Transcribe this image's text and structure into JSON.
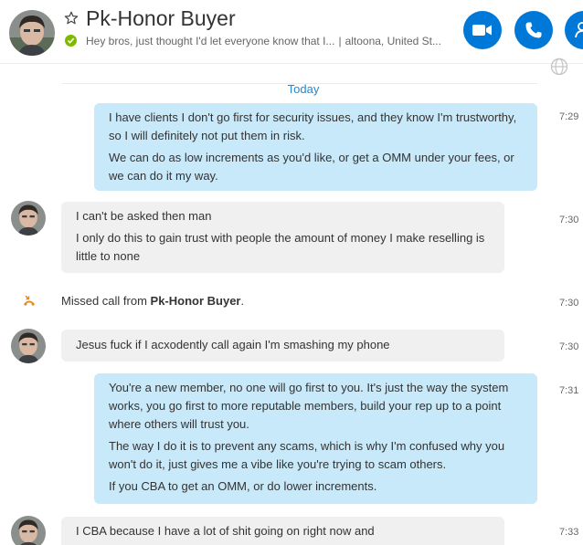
{
  "contact": {
    "name": "Pk-Honor Buyer",
    "mood": "Hey bros, just thought I'd let everyone know that I...",
    "separator": "|",
    "location": "altoona, United St..."
  },
  "colors": {
    "accent": "#0078d7",
    "outgoing_bubble": "#c7e9fa",
    "incoming_bubble": "#f0f0f0",
    "online": "#7fba00",
    "date": "#1e88d6",
    "missed_call": "#e8881a"
  },
  "icons": {
    "favorite": "star-icon",
    "status": "online-check-icon",
    "video": "video-camera-icon",
    "call": "phone-icon",
    "add": "add-people-icon",
    "translate": "globe-icon",
    "missed": "missed-call-icon"
  },
  "conversation": {
    "date_label": "Today",
    "msg1": {
      "lines": [
        "I have clients I don't go first for security issues, and they know I'm trustworthy, so I will definitely not put them in risk.",
        "We can do as low increments as you'd like, or get a OMM under your fees, or we can do it my way."
      ],
      "time": "7:29"
    },
    "msg2": {
      "lines": [
        "I can't be asked then man",
        "I only do this to gain trust with people the amount of money I make reselling is little to none"
      ],
      "time": "7:30"
    },
    "missed_call": {
      "prefix": "Missed call from ",
      "name": "Pk-Honor Buyer",
      "suffix": ".",
      "time": "7:30"
    },
    "msg3": {
      "lines": [
        "Jesus fuck if I acxodently call again I'm smashing my phone"
      ],
      "time": "7:30"
    },
    "msg4": {
      "lines": [
        "You're a new member, no one will go first to you. It's just the way the system works, you go first to more reputable members, build your rep up to a point where others will trust you.",
        "The way I do it is to prevent any scams, which is why I'm confused why you won't do it, just gives me a vibe like you're trying to scam others.",
        "If you CBA to get an OMM, or do lower increments."
      ],
      "time": "7:31"
    },
    "msg5": {
      "lines": [
        "I CBA because I have a lot of shit going on right now and"
      ],
      "time": "7:33"
    }
  }
}
